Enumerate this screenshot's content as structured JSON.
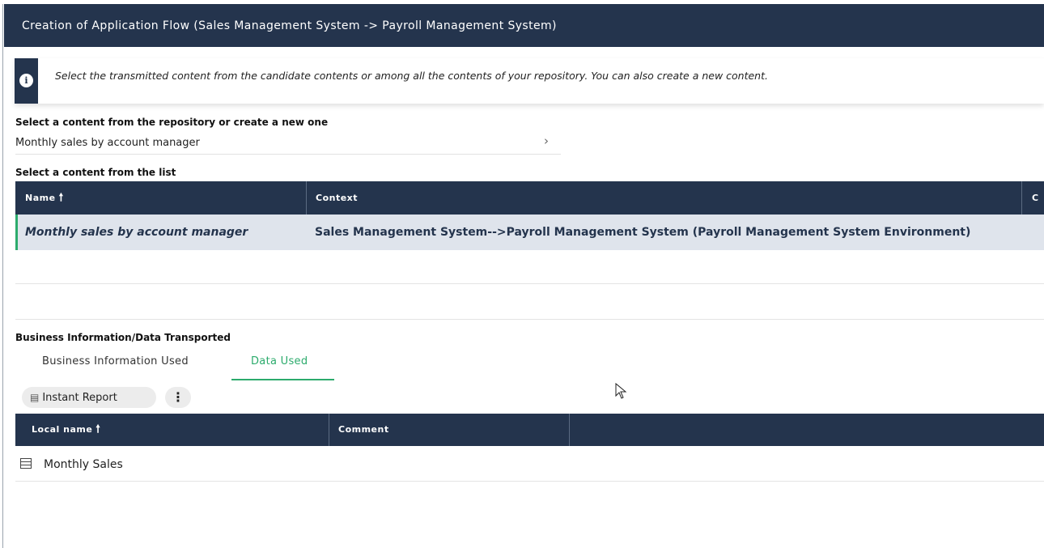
{
  "window": {
    "title": "Creation of Application Flow (Sales Management System -> Payroll Management System)"
  },
  "info": {
    "icon": "info-icon",
    "text": "Select the transmitted content from the candidate contents or among all the contents of your repository. You can also create a new content."
  },
  "repository": {
    "label": "Select a content from the repository or create a new one",
    "value": "Monthly sales by account manager",
    "chevron": "›"
  },
  "list": {
    "label": "Select a content from the list",
    "columns": {
      "name": "Name",
      "context": "Context",
      "third": "C"
    },
    "sort_arrow": "🠕",
    "rows": [
      {
        "name": "Monthly sales by account manager",
        "context": "Sales Management System-->Payroll Management System (Payroll Management System Environment)"
      }
    ]
  },
  "business": {
    "label": "Business Information/Data Transported",
    "tabs": [
      {
        "label": "Business Information Used",
        "active": false
      },
      {
        "label": "Data Used",
        "active": true
      }
    ],
    "toolbar": {
      "instant_report_label": "Instant Report",
      "more_label": "⋮"
    },
    "grid": {
      "columns": {
        "local_name": "Local name",
        "comment": "Comment"
      },
      "sort_arrow": "🠕",
      "rows": [
        {
          "local_name": "Monthly Sales",
          "icon": "table-icon"
        }
      ]
    }
  },
  "colors": {
    "header_bg": "#24344d",
    "accent_green": "#2cab6c",
    "selected_row_bg": "#dfe4ec"
  }
}
